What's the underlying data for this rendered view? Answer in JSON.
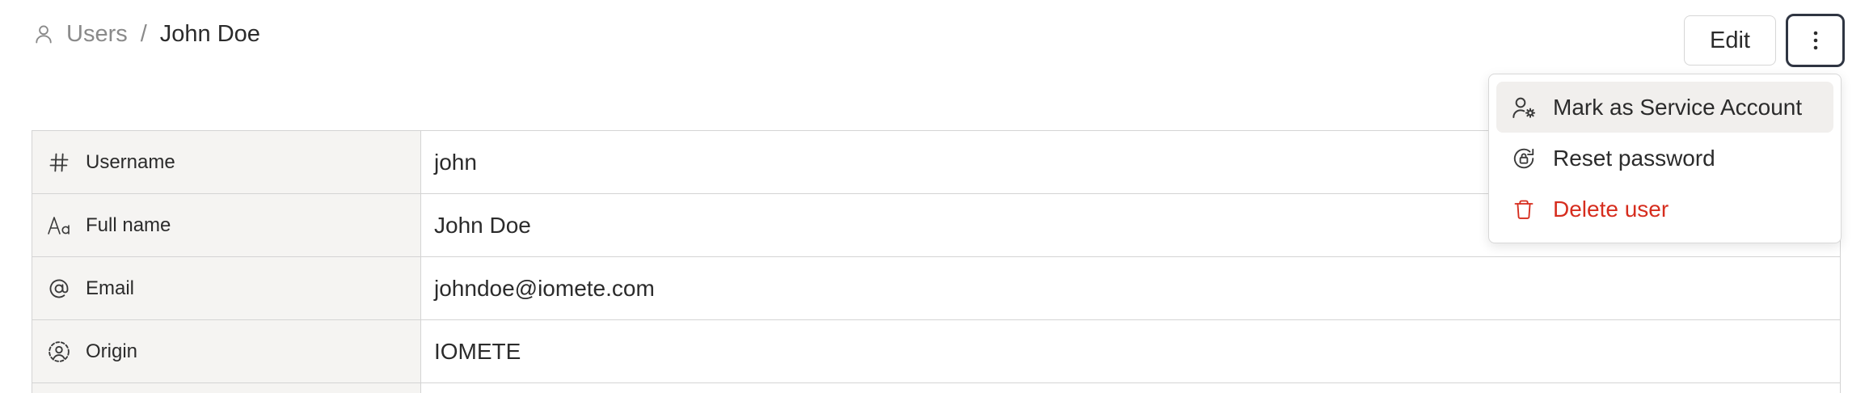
{
  "breadcrumb": {
    "icon": "user-icon",
    "parent": "Users",
    "separator": "/",
    "current": "John Doe"
  },
  "header": {
    "edit_label": "Edit",
    "more_icon": "more-vertical-icon"
  },
  "details": {
    "rows": [
      {
        "icon": "hash-icon",
        "label": "Username",
        "value": "john"
      },
      {
        "icon": "font-icon",
        "label": "Full name",
        "value": "John Doe"
      },
      {
        "icon": "at-sign-icon",
        "label": "Email",
        "value": "johndoe@iomete.com"
      },
      {
        "icon": "user-circle-icon",
        "label": "Origin",
        "value": "IOMETE"
      }
    ]
  },
  "menu": {
    "items": [
      {
        "icon": "user-gear-icon",
        "label": "Mark as Service Account",
        "state": "hover"
      },
      {
        "icon": "lock-reset-icon",
        "label": "Reset password"
      },
      {
        "icon": "trash-icon",
        "label": "Delete user",
        "color": "#d62d1e"
      }
    ]
  },
  "colors": {
    "key_background": "#f5f4f2",
    "border": "#d4d4d4",
    "danger": "#d62d1e",
    "focus_ring": "#2f3542"
  }
}
